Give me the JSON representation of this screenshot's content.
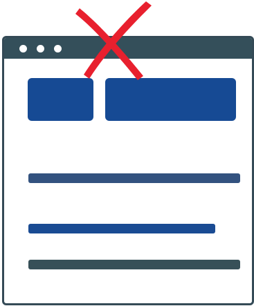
{
  "colors": {
    "titlebar": "#344f5a",
    "block": "#164a94",
    "line_primary": "#33527f",
    "line_secondary": "#1a4b93",
    "line_tertiary": "#375058",
    "window_border": "#344a56",
    "x_mark": "#e8202e"
  },
  "window": {
    "controls": [
      "dot",
      "dot",
      "dot"
    ]
  },
  "overlay": {
    "icon": "x-mark-icon",
    "meaning": "incorrect"
  }
}
